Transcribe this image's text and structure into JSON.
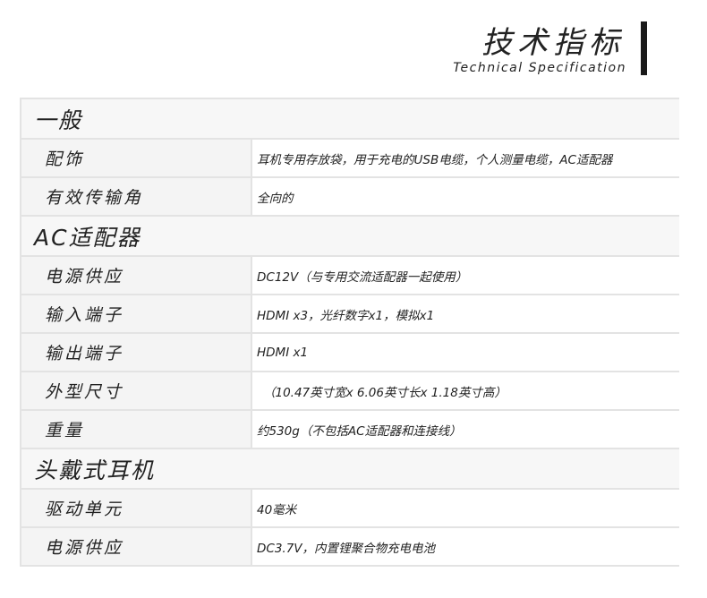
{
  "header": {
    "title_zh": "技术指标",
    "title_en": "Technical Specification"
  },
  "sections": [
    {
      "title": "一般",
      "items": [
        {
          "label": "配饰",
          "value": "耳机专用存放袋，用于充电的USB电缆，个人测量电缆，AC适配器"
        },
        {
          "label": "有效传输角",
          "value": "全向的"
        }
      ]
    },
    {
      "title": "AC适配器",
      "items": [
        {
          "label": "电源供应",
          "value": "DC12V（与专用交流适配器一起使用）"
        },
        {
          "label": "输入端子",
          "value": "HDMI x3，光纤数字x1，模拟x1"
        },
        {
          "label": "输出端子",
          "value": "HDMI x1"
        },
        {
          "label": "外型尺寸",
          "value": "（10.47英寸宽x 6.06英寸长x 1.18英寸高）"
        },
        {
          "label": "重量",
          "value": "约530g（不包括AC适配器和连接线）"
        }
      ]
    },
    {
      "title": "头戴式耳机",
      "items": [
        {
          "label": "驱动单元",
          "value": "40毫米"
        },
        {
          "label": "电源供应",
          "value": "DC3.7V，内置锂聚合物充电电池"
        }
      ]
    }
  ]
}
